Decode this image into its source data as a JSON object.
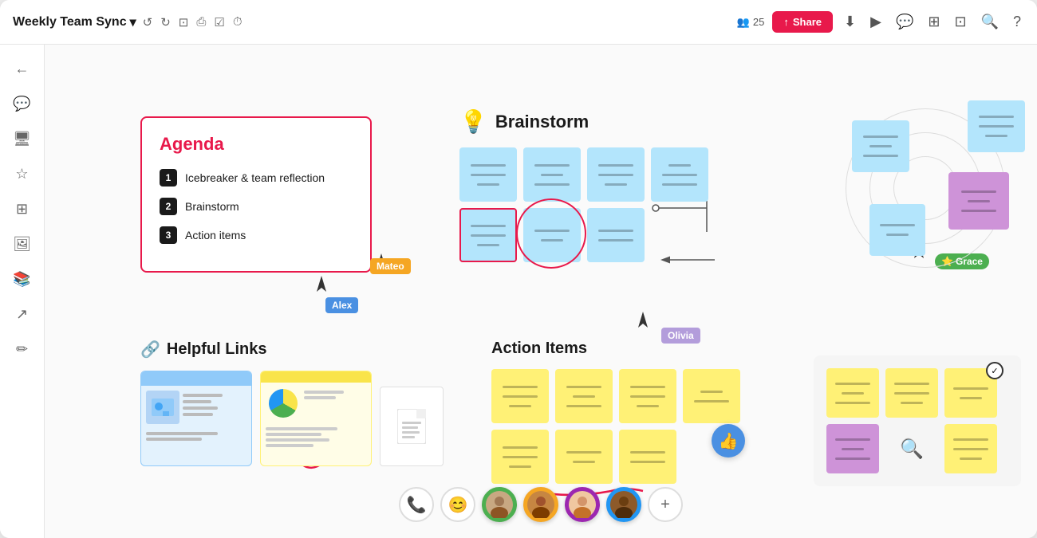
{
  "app": {
    "title": "Weekly Team Sync",
    "title_dropdown": "▾"
  },
  "header": {
    "collaborators_count": "25",
    "share_label": "Share",
    "tools": [
      "↺",
      "↻",
      "⊡",
      "🖨",
      "☑",
      "⏱"
    ]
  },
  "sidebar": {
    "items": [
      {
        "icon": "←",
        "name": "back"
      },
      {
        "icon": "💬",
        "name": "comments"
      },
      {
        "icon": "🖥",
        "name": "screens"
      },
      {
        "icon": "☆",
        "name": "favorites"
      },
      {
        "icon": "⊞",
        "name": "frames"
      },
      {
        "icon": "🖼",
        "name": "images"
      },
      {
        "icon": "📚",
        "name": "library"
      },
      {
        "icon": "↗",
        "name": "export"
      },
      {
        "icon": "✏",
        "name": "draw"
      }
    ]
  },
  "agenda": {
    "title": "Agenda",
    "items": [
      {
        "num": "1",
        "text": "Icebreaker & team reflection"
      },
      {
        "num": "2",
        "text": "Brainstorm"
      },
      {
        "num": "3",
        "text": "Action items"
      }
    ]
  },
  "cursors": {
    "mateo": {
      "label": "Mateo",
      "color": "#f5a623"
    },
    "alex": {
      "label": "Alex",
      "color": "#4a90e2"
    },
    "olivia": {
      "label": "Olivia",
      "color": "#b39ddb"
    },
    "grace": {
      "label": "Grace",
      "color": "#4caf50"
    }
  },
  "brainstorm": {
    "title": "Brainstorm",
    "lightbulb": "💡"
  },
  "helpful_links": {
    "title": "Helpful Links",
    "icon": "🔗"
  },
  "action_items": {
    "title": "Action Items"
  },
  "participants": [
    {
      "type": "icon",
      "icon": "📞"
    },
    {
      "type": "icon",
      "icon": "😊"
    },
    {
      "type": "avatar",
      "color": "#4caf50"
    },
    {
      "type": "avatar",
      "color": "#f5a623"
    },
    {
      "type": "avatar",
      "color": "#9c27b0"
    },
    {
      "type": "avatar",
      "color": "#2196f3"
    },
    {
      "type": "add",
      "icon": "+"
    }
  ]
}
